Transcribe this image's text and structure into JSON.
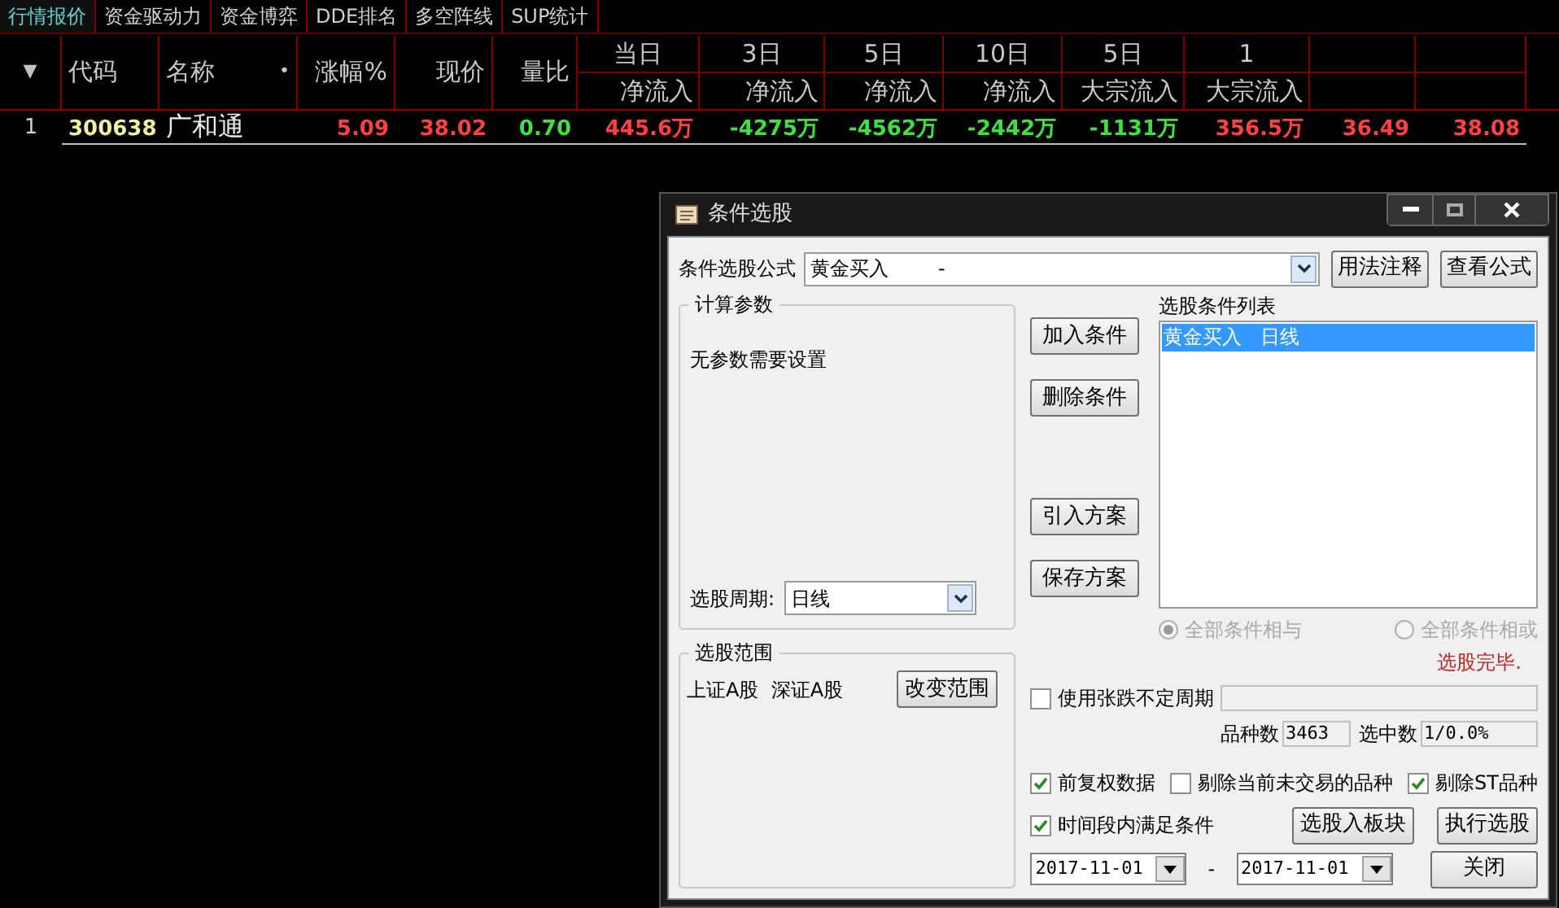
{
  "tabs": [
    {
      "label": "行情报价",
      "selected": true
    },
    {
      "label": "资金驱动力",
      "selected": false
    },
    {
      "label": "资金博弈",
      "selected": false
    },
    {
      "label": "DDE排名",
      "selected": false
    },
    {
      "label": "多空阵线",
      "selected": false
    },
    {
      "label": "SUP统计",
      "selected": false
    }
  ],
  "table": {
    "sort_glyph": "▼",
    "columns": [
      {
        "kind": "single",
        "label": "代码"
      },
      {
        "kind": "single",
        "label": "名称",
        "marker": "•"
      },
      {
        "kind": "single",
        "label": "涨幅%"
      },
      {
        "kind": "single",
        "label": "现价"
      },
      {
        "kind": "single",
        "label": "量比"
      },
      {
        "kind": "double",
        "line1": "当日",
        "line2": "净流入"
      },
      {
        "kind": "double",
        "line1": "3日",
        "line2": "净流入"
      },
      {
        "kind": "double",
        "line1": "5日",
        "line2": "净流入"
      },
      {
        "kind": "double",
        "line1": "10日",
        "line2": "净流入"
      },
      {
        "kind": "double",
        "line1": "5日",
        "line2": "大宗流入"
      },
      {
        "kind": "double",
        "line1": "1",
        "line2": "大宗流入"
      },
      {
        "kind": "double"
      },
      {
        "kind": "double"
      }
    ],
    "rows": [
      {
        "index": "1",
        "cells": [
          {
            "text": "300638",
            "color": "#f0f0a0"
          },
          {
            "text": "广和通",
            "color": "#e8e8e8"
          },
          {
            "text": "5.09",
            "color": "#ff4040"
          },
          {
            "text": "38.02",
            "color": "#ff4040"
          },
          {
            "text": "0.70",
            "color": "#40e040"
          },
          {
            "text": "445.6万",
            "color": "#ff4040"
          },
          {
            "text": "-4275万",
            "color": "#40e040"
          },
          {
            "text": "-4562万",
            "color": "#40e040"
          },
          {
            "text": "-2442万",
            "color": "#40e040"
          },
          {
            "text": "-1131万",
            "color": "#40e040"
          },
          {
            "text": "356.5万",
            "color": "#ff4040"
          },
          {
            "text": "36.49",
            "color": "#ff4040"
          },
          {
            "text": "38.08",
            "color": "#ff4040"
          }
        ]
      }
    ]
  },
  "dialog": {
    "title": "条件选股",
    "formula_label": "条件选股公式",
    "formula_value": "黄金买入        -",
    "top_buttons": [
      "用法注释",
      "查看公式"
    ],
    "params": {
      "legend": "计算参数",
      "message": "无参数需要设置",
      "period_label": "选股周期:",
      "period_value": "日线"
    },
    "range": {
      "legend": "选股范围",
      "value": "上证A股  深证A股",
      "button": "改变范围"
    },
    "middle_buttons": [
      "加入条件",
      "删除条件",
      "引入方案",
      "保存方案"
    ],
    "list": {
      "label": "选股条件列表",
      "items": [
        {
          "text": "黄金买入   日线",
          "selected": true
        }
      ]
    },
    "radios": [
      {
        "label": "全部条件相与",
        "selected": true,
        "disabled": true
      },
      {
        "label": "全部条件相或",
        "selected": false,
        "disabled": true
      }
    ],
    "status": "选股完毕.",
    "variable_period": {
      "label": "使用张跌不定周期",
      "checked": false
    },
    "counts": [
      {
        "label": "品种数",
        "value": "3463"
      },
      {
        "label": "选中数",
        "value": "1/0.0%"
      }
    ],
    "options": [
      {
        "label": "前复权数据",
        "checked": true
      },
      {
        "label": "剔除当前未交易的品种",
        "checked": false
      },
      {
        "label": "剔除ST品种",
        "checked": true
      }
    ],
    "time_condition": {
      "label": "时间段内满足条件",
      "checked": true
    },
    "action_buttons": [
      "选股入板块",
      "执行选股"
    ],
    "date_from": "2017-11-01",
    "date_separator": "-",
    "date_to": "2017-11-01",
    "close_button": "关闭"
  }
}
